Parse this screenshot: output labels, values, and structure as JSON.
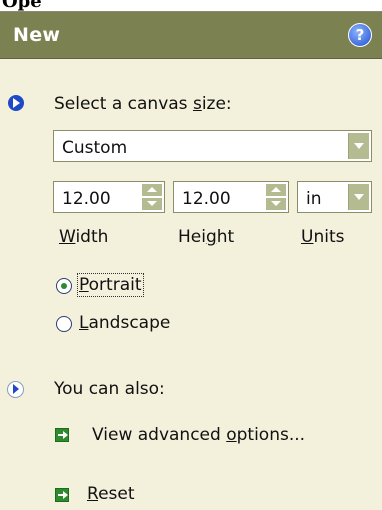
{
  "header": {
    "top_strip_text": "Ope",
    "title": "New",
    "help_glyph": "?"
  },
  "canvas_size": {
    "section_prefix": "Select a canvas ",
    "section_access": "s",
    "section_suffix": "ize:",
    "preset": "Custom",
    "width_value": "12.00",
    "height_value": "12.00",
    "units_value": "in",
    "width_label_access": "W",
    "width_label_rest": "idth",
    "height_label_pre": "Hei",
    "height_label_access": "g",
    "height_label_rest": "ht",
    "units_label_access": "U",
    "units_label_rest": "nits"
  },
  "orientation": {
    "portrait_access": "P",
    "portrait_rest": "ortrait",
    "landscape_access": "L",
    "landscape_rest": "andscape",
    "selected": "portrait"
  },
  "also": {
    "section_label": "You can also:",
    "advanced_pre": "View advanced ",
    "advanced_access": "o",
    "advanced_rest": "ptions...",
    "reset_access": "R",
    "reset_rest": "eset"
  },
  "colors": {
    "panel_bg": "#f3f1dc",
    "titlebar_bg": "#7c8152",
    "accent_blue": "#1f49c7",
    "accent_green": "#2d8a2d"
  }
}
